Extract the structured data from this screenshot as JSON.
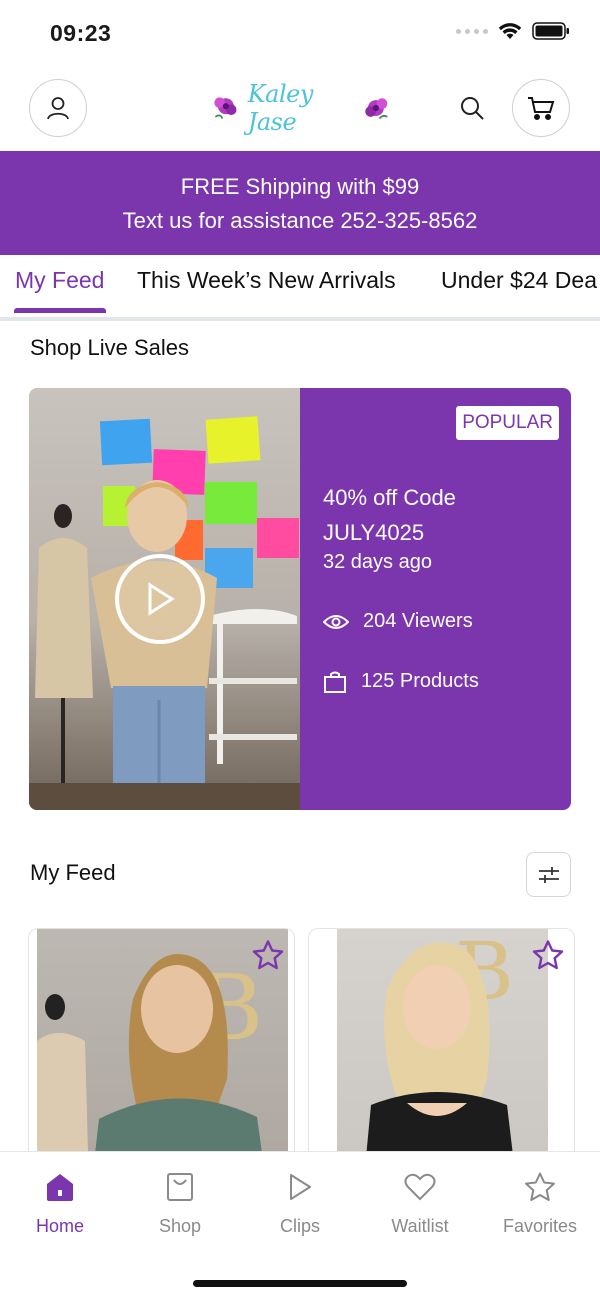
{
  "status_bar": {
    "time": "09:23"
  },
  "header": {
    "logo_text": "Kaley Jase",
    "icons": {
      "account": "user-icon",
      "search": "search-icon",
      "cart": "cart-icon"
    }
  },
  "promo": {
    "line1": "FREE Shipping with $99",
    "line2": "Text us for assistance 252-325-8562"
  },
  "tabs": [
    {
      "label": "My Feed",
      "active": true
    },
    {
      "label": "This Week’s New Arrivals",
      "active": false
    },
    {
      "label": "Under $24 Dea",
      "active": false
    }
  ],
  "live_section": {
    "title": "Shop Live Sales",
    "card": {
      "badge": "POPULAR",
      "title": "40% off Code JULY4025",
      "date": "32 days ago",
      "viewers": "204 Viewers",
      "products": "125 Products"
    }
  },
  "feed_section": {
    "title": "My Feed"
  },
  "bottom_nav": [
    {
      "label": "Home",
      "icon": "home-icon",
      "active": true
    },
    {
      "label": "Shop",
      "icon": "shopping-bag-icon",
      "active": false
    },
    {
      "label": "Clips",
      "icon": "play-icon",
      "active": false
    },
    {
      "label": "Waitlist",
      "icon": "heart-icon",
      "active": false
    },
    {
      "label": "Favorites",
      "icon": "star-icon",
      "active": false
    }
  ],
  "colors": {
    "brand_purple": "#7b36ad",
    "inactive_gray": "#8a8a8a"
  }
}
